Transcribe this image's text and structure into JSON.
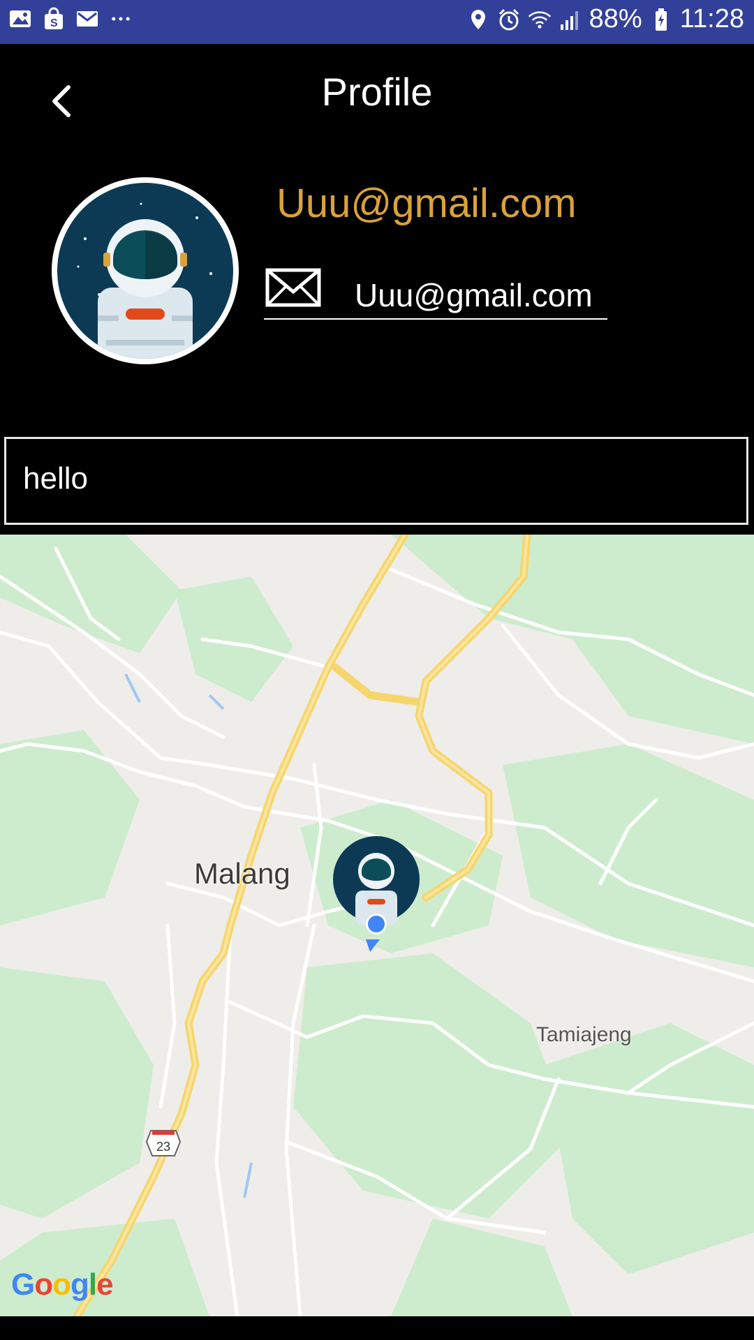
{
  "status_bar": {
    "battery": "88%",
    "time": "11:28",
    "left_icons": [
      "gallery-icon",
      "shopping-icon",
      "mail-icon",
      "more-icon"
    ],
    "right_icons": [
      "location-icon",
      "alarm-icon",
      "wifi-icon",
      "signal-icon",
      "battery-icon"
    ]
  },
  "header": {
    "title": "Profile",
    "back_icon": "chevron-left-icon"
  },
  "profile": {
    "display_name": "Uuu@gmail.com",
    "email": "Uuu@gmail.com",
    "email_icon": "envelope-icon",
    "avatar": "astronaut-avatar"
  },
  "status_message": "hello",
  "map": {
    "labels": {
      "city": "Malang",
      "place": "Tamiajeng",
      "route_shield": "23"
    },
    "attribution": "Google",
    "colors": {
      "land": "#efede9",
      "park": "#cdeccd",
      "road": "#ffffff",
      "highway": "#fbd96a",
      "marker": "#4285f4"
    }
  },
  "colors": {
    "status_bar": "#33409a",
    "accent": "#d9a23a",
    "background": "#000000"
  }
}
